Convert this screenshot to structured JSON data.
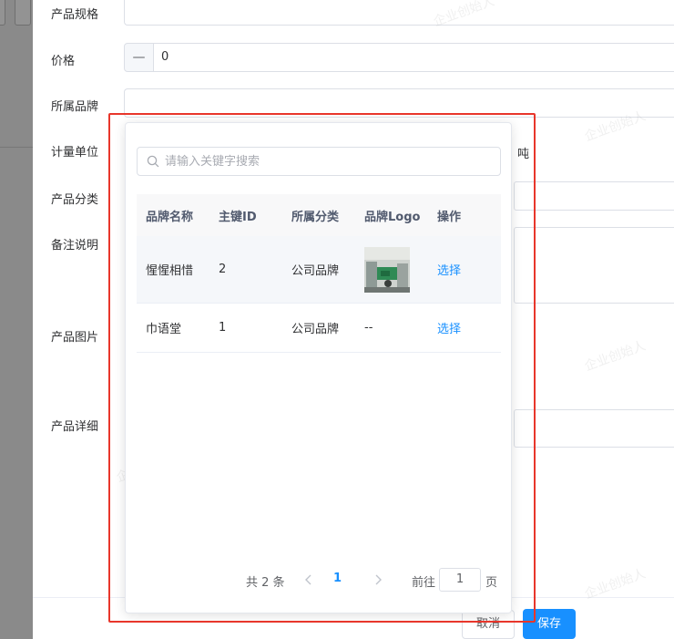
{
  "form": {
    "labels": {
      "spec": "产品规格",
      "price": "价格",
      "brand": "所属品牌",
      "unit": "计量单位",
      "category": "产品分类",
      "remark": "备注说明",
      "image": "产品图片",
      "detail": "产品详细"
    },
    "price_minus": "—",
    "price_value": "0",
    "unit_suffix": "吨"
  },
  "footer": {
    "cancel_label": "取消",
    "save_label": "保存"
  },
  "popover": {
    "search": {
      "placeholder": "请输入关键字搜索",
      "value": ""
    },
    "table": {
      "columns": [
        "品牌名称",
        "主键ID",
        "所属分类",
        "品牌Logo",
        "操作"
      ],
      "rows": [
        {
          "name": "惺惺相惜",
          "id": "2",
          "category": "公司品牌",
          "logo": "",
          "action": "选择"
        },
        {
          "name": "巾语堂",
          "id": "1",
          "category": "公司品牌",
          "logo": "--",
          "action": "选择"
        }
      ]
    },
    "pagination": {
      "total": "共 2 条",
      "current_page": "1",
      "goto_label": "前往",
      "goto_value": "1",
      "page_suffix": "页"
    }
  },
  "watermark": "企业创始人",
  "colors": {
    "primary": "#1890ff",
    "highlight_frame": "#e8362b"
  }
}
